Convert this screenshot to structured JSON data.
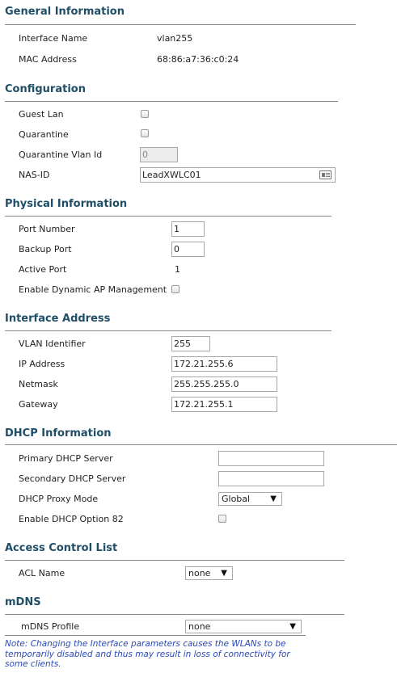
{
  "general": {
    "title": "General Information",
    "interface_name_label": "Interface Name",
    "interface_name_value": "vlan255",
    "mac_label": "MAC Address",
    "mac_value": "68:86:a7:36:c0:24"
  },
  "configuration": {
    "title": "Configuration",
    "guest_lan_label": "Guest Lan",
    "guest_lan_checked": false,
    "quarantine_label": "Quarantine",
    "quarantine_checked": false,
    "quarantine_vlan_label": "Quarantine Vlan Id",
    "quarantine_vlan_value": "0",
    "nas_id_label": "NAS-ID",
    "nas_id_value": "LeadXWLC01",
    "nas_id_icon": "contact-card-icon"
  },
  "physical": {
    "title": "Physical Information",
    "port_number_label": "Port Number",
    "port_number_value": "1",
    "backup_port_label": "Backup Port",
    "backup_port_value": "0",
    "active_port_label": "Active Port",
    "active_port_value": "1",
    "dynamic_ap_label": "Enable Dynamic AP Management",
    "dynamic_ap_checked": false
  },
  "interface_address": {
    "title": "Interface Address",
    "vlan_label": "VLAN Identifier",
    "vlan_value": "255",
    "ip_label": "IP Address",
    "ip_value": "172.21.255.6",
    "netmask_label": "Netmask",
    "netmask_value": "255.255.255.0",
    "gateway_label": "Gateway",
    "gateway_value": "172.21.255.1"
  },
  "dhcp": {
    "title": "DHCP Information",
    "primary_label": "Primary DHCP Server",
    "primary_value": "",
    "secondary_label": "Secondary DHCP Server",
    "secondary_value": "",
    "proxy_label": "DHCP Proxy Mode",
    "proxy_value": "Global",
    "option82_label": "Enable DHCP Option 82",
    "option82_checked": false
  },
  "acl": {
    "title": "Access Control List",
    "acl_label": "ACL Name",
    "acl_value": "none"
  },
  "mdns": {
    "title": "mDNS",
    "profile_label": "mDNS Profile",
    "profile_value": "none"
  },
  "note": "Note: Changing the Interface parameters causes the WLANs to be temporarily disabled and thus may result in loss of connectivity for some clients.",
  "colors": {
    "section_title": "#1f4e66",
    "note_text": "#2a48b8"
  }
}
